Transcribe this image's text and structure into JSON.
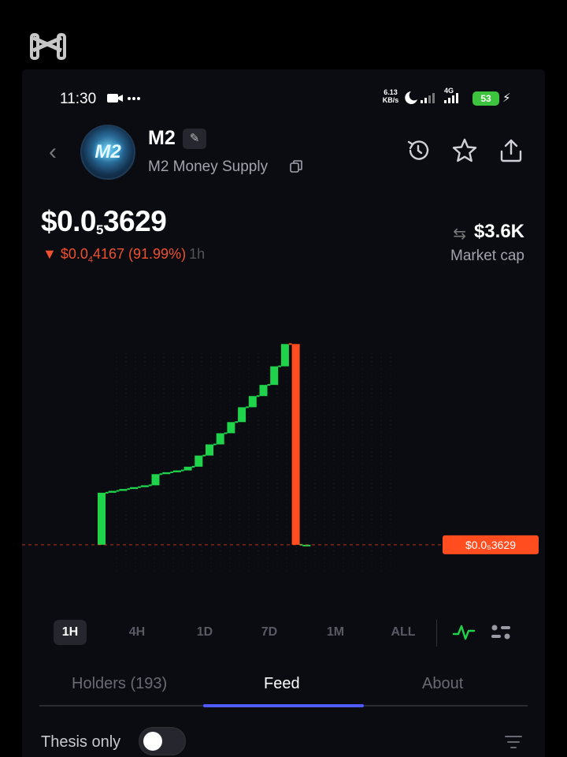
{
  "status_bar": {
    "time": "11:30",
    "dots": "•••",
    "net_speed": "6.13",
    "net_unit": "KB/s",
    "network": "4G",
    "battery": "53"
  },
  "header": {
    "avatar_text": "M2",
    "ticker": "M2",
    "name": "M2 Money Supply"
  },
  "price": {
    "prefix": "$0.0",
    "zeros": "5",
    "digits": "3629",
    "change_prefix": "▼ $0.0",
    "change_zeros": "4",
    "change_digits": "4167 (91.99%)",
    "change_period": "1h"
  },
  "market_cap": {
    "value": "$3.6K",
    "label": "Market cap"
  },
  "chart_data": {
    "type": "candlestick",
    "current_price_label": "$0.0₅3629",
    "colors": {
      "up": "#1fd44a",
      "down": "#ff4d1f",
      "price_line": "#ff4d1f"
    },
    "candles": [
      {
        "o": 0.1,
        "c": 0.24
      },
      {
        "o": 0.24,
        "c": 0.245
      },
      {
        "o": 0.245,
        "c": 0.25
      },
      {
        "o": 0.25,
        "c": 0.255
      },
      {
        "o": 0.255,
        "c": 0.26
      },
      {
        "o": 0.26,
        "c": 0.29
      },
      {
        "o": 0.29,
        "c": 0.295
      },
      {
        "o": 0.295,
        "c": 0.3
      },
      {
        "o": 0.3,
        "c": 0.31
      },
      {
        "o": 0.31,
        "c": 0.34
      },
      {
        "o": 0.34,
        "c": 0.37
      },
      {
        "o": 0.37,
        "c": 0.4
      },
      {
        "o": 0.4,
        "c": 0.43
      },
      {
        "o": 0.43,
        "c": 0.47
      },
      {
        "o": 0.47,
        "c": 0.5
      },
      {
        "o": 0.5,
        "c": 0.53
      },
      {
        "o": 0.53,
        "c": 0.58
      },
      {
        "o": 0.58,
        "c": 0.64
      },
      {
        "o": 0.64,
        "c": 0.1
      },
      {
        "o": 0.1,
        "c": 0.1
      }
    ],
    "y_range": [
      0,
      0.7
    ]
  },
  "timeframes": [
    "1H",
    "4H",
    "1D",
    "7D",
    "1M",
    "ALL"
  ],
  "active_timeframe": "1H",
  "tabs": [
    {
      "label": "Holders (193)",
      "active": false
    },
    {
      "label": "Feed",
      "active": true
    },
    {
      "label": "About",
      "active": false
    }
  ],
  "filter": {
    "thesis_label": "Thesis only",
    "thesis_on": false
  }
}
